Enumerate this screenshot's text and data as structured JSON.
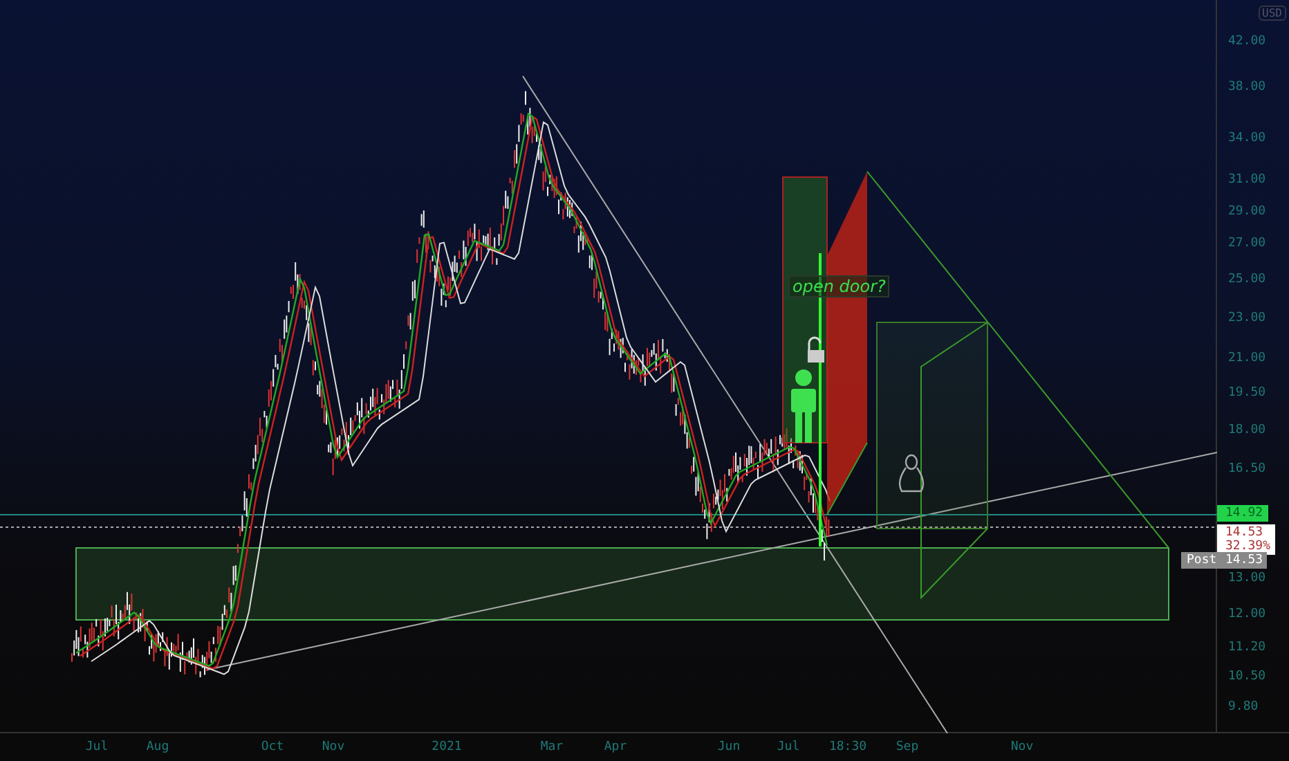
{
  "currency": "USD",
  "price_axis": {
    "ticks": [
      "42.00",
      "38.00",
      "34.00",
      "31.00",
      "29.00",
      "27.00",
      "25.00",
      "23.00",
      "21.00",
      "19.50",
      "18.00",
      "16.50",
      "13.00",
      "12.00",
      "11.20",
      "10.50",
      "9.80"
    ]
  },
  "price_tags": [
    {
      "kind": "last",
      "value": "14.92",
      "color": "#22d34a"
    },
    {
      "kind": "change",
      "value": "14.53",
      "change": "32.39%"
    },
    {
      "kind": "post",
      "label": "Post",
      "value": "14.53"
    }
  ],
  "time_axis": {
    "labels": [
      "Jul",
      "Aug",
      "Oct",
      "Nov",
      "2021",
      "Mar",
      "Apr",
      "Jun",
      "Jul",
      "18:30",
      "Sep",
      "Nov"
    ]
  },
  "annotation": {
    "text": "open door?"
  }
}
